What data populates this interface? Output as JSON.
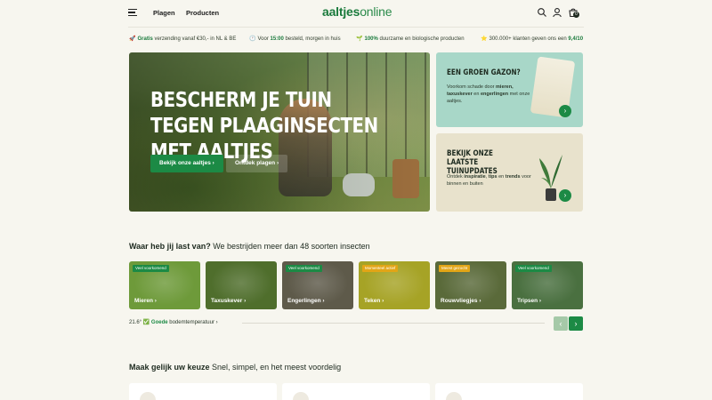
{
  "header": {
    "nav": [
      "Plagen",
      "Producten"
    ],
    "logo_bold": "aaltjes",
    "logo_rest": "online",
    "cart_count": "0",
    "icons": [
      "menu-icon",
      "search-icon",
      "user-icon",
      "cart-icon"
    ]
  },
  "usp": [
    {
      "icon": "🚀",
      "strong": "Gratis",
      "text": " verzending vanaf €30,- in NL & BE"
    },
    {
      "icon": "🕐",
      "pre": "Voor ",
      "strong": "15:00",
      "text": " besteld, morgen in huis"
    },
    {
      "icon": "🌱",
      "strong": "100%",
      "text": " duurzame en biologische producten"
    },
    {
      "icon": "⭐",
      "pre": "300.000+ klanten geven ons een ",
      "strong": "9,4/10",
      "text": ""
    }
  ],
  "hero": {
    "title": "Bescherm je tuin tegen plaaginsecten met aaltjes",
    "btn_primary": "Bekijk onze aaltjes",
    "btn_secondary": "Ontdek plagen"
  },
  "promo1": {
    "title": "Een groen gazon?",
    "text_a": "Voorkom schade door ",
    "text_b": "mieren, taxuskever",
    "text_c": " en ",
    "text_d": "engerlingen",
    "text_e": " met onze aaltjes."
  },
  "promo2": {
    "title": "Bekijk onze laatste tuinupdates",
    "text_a": "Ontdek ",
    "text_b": "inspiratie",
    "text_c": ", ",
    "text_d": "tips",
    "text_e": " en ",
    "text_f": "trends",
    "text_g": " voor binnen en buiten"
  },
  "insects": {
    "title_bold": "Waar heb jij last van?",
    "title_rest": " We bestrijden meer dan 48 soorten insecten",
    "cards": [
      {
        "badge": "Veel voorkomend",
        "label": "Mieren",
        "badge_color": "#1c8a45",
        "bg": "#6e9a3a"
      },
      {
        "badge": "",
        "label": "Taxuskever",
        "badge_color": "",
        "bg": "#4f6e2c"
      },
      {
        "badge": "Veel voorkomend",
        "label": "Engerlingen",
        "badge_color": "#1c8a45",
        "bg": "#5e5a4a"
      },
      {
        "badge": "Momenteel actief",
        "label": "Teken",
        "badge_color": "#e2a516",
        "bg": "#a6a326"
      },
      {
        "badge": "Meest gezocht",
        "label": "Rouwvliegjes",
        "badge_color": "#e2a516",
        "bg": "#5a6a3a"
      },
      {
        "badge": "Veel voorkomend",
        "label": "Tripsen",
        "badge_color": "#1c8a45",
        "bg": "#4a7040"
      }
    ],
    "temp_value": "21.6°",
    "temp_status": "Goede",
    "temp_text": " bodemtemperatuur"
  },
  "choice": {
    "title_bold": "Maak gelijk uw keuze",
    "title_rest": " Snel, simpel, en het meest voordelig"
  }
}
